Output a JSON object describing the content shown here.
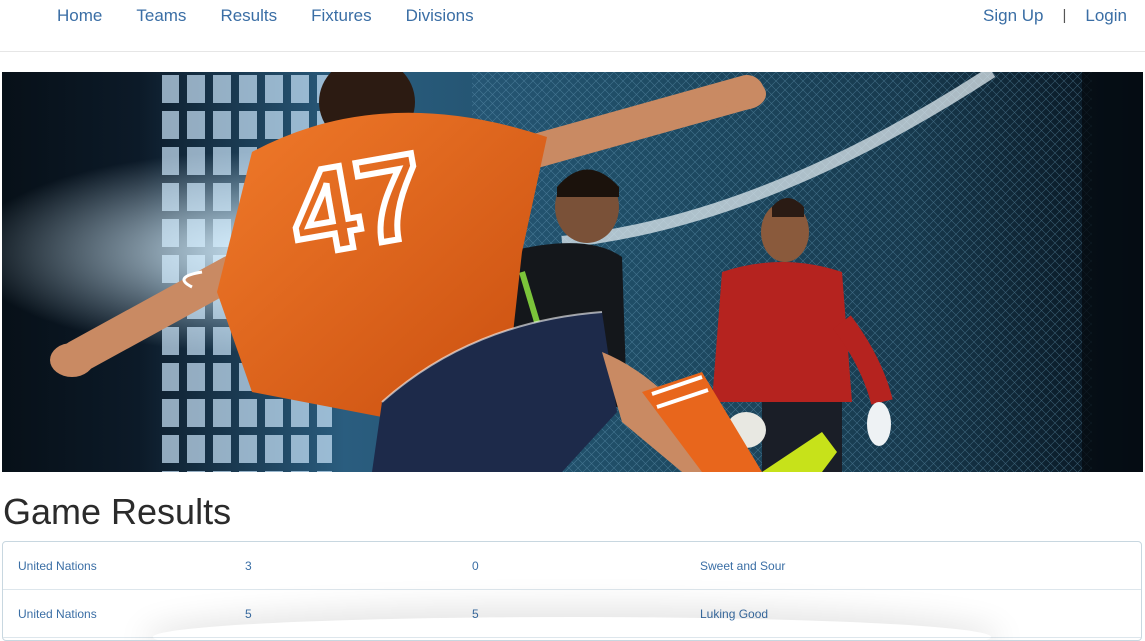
{
  "nav": {
    "left": [
      "Home",
      "Teams",
      "Results",
      "Fixtures",
      "Divisions"
    ],
    "signup": "Sign Up",
    "separator": "|",
    "login": "Login"
  },
  "hero": {
    "jersey_number": "47",
    "image_name": "futsal-action-photo"
  },
  "page_title": "Game Results",
  "results": [
    {
      "home": "United Nations",
      "home_score": "3",
      "away_score": "0",
      "away": "Sweet and Sour"
    },
    {
      "home": "United Nations",
      "home_score": "5",
      "away_score": "5",
      "away": "Luking Good"
    }
  ],
  "colors": {
    "link": "#3a6ea5",
    "jersey": "#e8661c",
    "shorts": "#1d2a4a",
    "keeper": "#b5231f",
    "boot": "#c7e21a"
  }
}
